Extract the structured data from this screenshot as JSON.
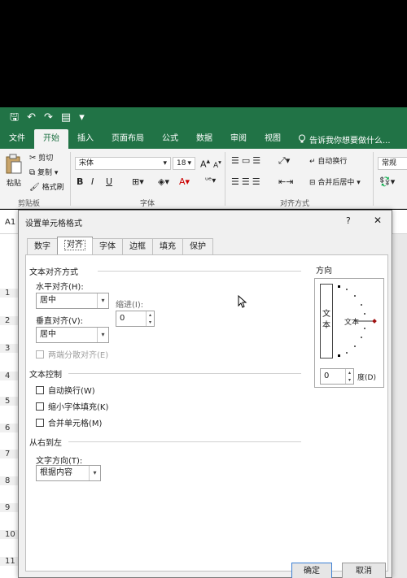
{
  "qat": {
    "save": "🖫",
    "undo": "↶",
    "redo": "↷",
    "form": "▤",
    "more": "▾"
  },
  "tabs": [
    "文件",
    "开始",
    "插入",
    "页面布局",
    "公式",
    "数据",
    "审阅",
    "视图"
  ],
  "active_tab": "开始",
  "tell_me": "告诉我你想要做什么...",
  "ribbon": {
    "paste": "粘贴",
    "cut": "剪切",
    "copy": "复制",
    "format_painter": "格式刷",
    "clipboard_label": "剪贴板",
    "font_name": "宋体",
    "font_size": "18",
    "grow": "A",
    "shrink": "A",
    "bold": "B",
    "italic": "I",
    "underline": "U",
    "font_label": "字体",
    "wrap_text": "自动换行",
    "merge_center": "合并后居中",
    "align_label": "对齐方式",
    "number_format": "常规"
  },
  "namebox": "A1",
  "rows": [
    "1",
    "2",
    "3",
    "4",
    "5",
    "6",
    "7",
    "8",
    "9",
    "10",
    "11"
  ],
  "dialog": {
    "title": "设置单元格格式",
    "help": "?",
    "close": "✕",
    "tabs": [
      "数字",
      "对齐",
      "字体",
      "边框",
      "填充",
      "保护"
    ],
    "active_tab": "对齐",
    "text_alignment_section": "文本对齐方式",
    "horizontal_label": "水平对齐(H):",
    "horizontal_value": "居中",
    "indent_label": "缩进(I):",
    "indent_value": "0",
    "vertical_label": "垂直对齐(V):",
    "vertical_value": "居中",
    "distributed_label": "两端分散对齐(E)",
    "text_control_section": "文本控制",
    "wrap_label": "自动换行(W)",
    "shrink_label": "缩小字体填充(K)",
    "merge_label": "合并单元格(M)",
    "rtl_section": "从右到左",
    "direction_label": "文字方向(T):",
    "direction_value": "根据内容",
    "orientation_section": "方向",
    "vertical_text": "文\n本",
    "arc_text": "文本",
    "degree_value": "0",
    "degree_label": "度(D)",
    "ok": "确定",
    "cancel": "取消"
  }
}
